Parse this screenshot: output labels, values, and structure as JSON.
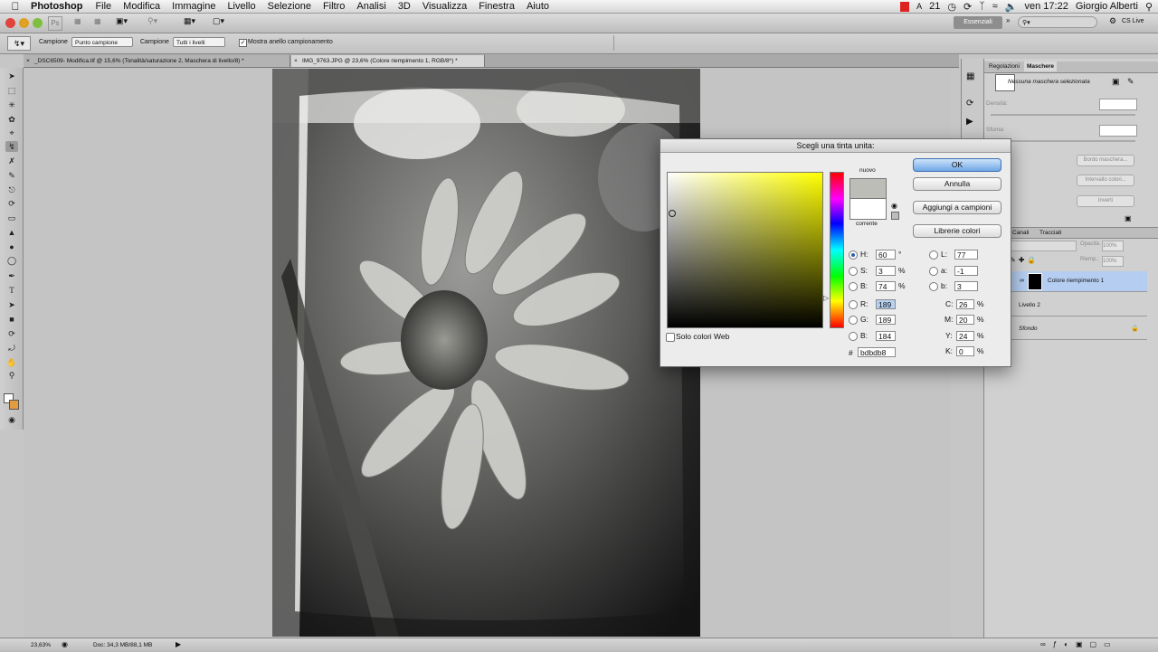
{
  "menubar": {
    "app_name": "Photoshop",
    "items": [
      "File",
      "Modifica",
      "Immagine",
      "Livello",
      "Selezione",
      "Filtro",
      "Analisi",
      "3D",
      "Visualizza",
      "Finestra",
      "Aiuto"
    ],
    "status_number": "21",
    "clock": "ven 17:22",
    "user": "Giorgio Alberti"
  },
  "appbar": {
    "workspace": "Essenziali",
    "cs_live": "CS Live"
  },
  "options": {
    "sample_label": "Campione",
    "sample_value": "Punto campione",
    "sample2_label": "Campione",
    "sample2_value": "Tutti i livelli",
    "ring_label": "Mostra anello campionamento"
  },
  "tabs": [
    {
      "label": "_DSC6509- Modifica.tif @ 15,6% (Tonalità/saturazione 2, Maschera di livello/8) *"
    },
    {
      "label": "IMG_9763.JPG @ 23,6% (Colore riempimento 1, RGB/8*) *"
    }
  ],
  "status": {
    "zoom": "23,63%",
    "doc": "Doc: 34,3 MB/88,1 MB"
  },
  "panels": {
    "tab_adjust": "Regolazioni",
    "tab_masks": "Maschere",
    "mask_text": "Nessuna maschera selezionata",
    "density_label": "Densità:",
    "feather_label": "Sfuma:",
    "btn_edge": "Bordo maschera...",
    "btn_range": "Intervallo colori...",
    "btn_invert": "Inverti",
    "tab_channels": "Canali",
    "tab_paths": "Tracciati",
    "opacity_label": "Opacità:",
    "opacity_value": "100%",
    "fill_label": "Riemp.:",
    "fill_value": "100%",
    "layers": [
      {
        "name": "Colore riempimento 1"
      },
      {
        "name": "Livello 2"
      },
      {
        "name": "Sfondo"
      }
    ]
  },
  "dialog": {
    "title": "Scegli una tinta unita:",
    "new_label": "nuovo",
    "current_label": "corrente",
    "ok": "OK",
    "cancel": "Annulla",
    "add_swatches": "Aggiungi a campioni",
    "libraries": "Librerie colori",
    "web_only": "Solo colori Web",
    "fields": {
      "H": {
        "label": "H:",
        "value": "60",
        "unit": "°"
      },
      "S": {
        "label": "S:",
        "value": "3",
        "unit": "%"
      },
      "B": {
        "label": "B:",
        "value": "74",
        "unit": "%"
      },
      "R": {
        "label": "R:",
        "value": "189"
      },
      "G": {
        "label": "G:",
        "value": "189"
      },
      "Bl": {
        "label": "B:",
        "value": "184"
      },
      "L": {
        "label": "L:",
        "value": "77"
      },
      "a": {
        "label": "a:",
        "value": "-1"
      },
      "b": {
        "label": "b:",
        "value": "3"
      },
      "C": {
        "label": "C:",
        "value": "26",
        "unit": "%"
      },
      "M": {
        "label": "M:",
        "value": "20",
        "unit": "%"
      },
      "Y": {
        "label": "Y:",
        "value": "24",
        "unit": "%"
      },
      "K": {
        "label": "K:",
        "value": "0",
        "unit": "%"
      }
    },
    "hex_label": "#",
    "hex_value": "bdbdb8",
    "new_color": "#bdbdb8",
    "current_color": "#ffffff"
  }
}
